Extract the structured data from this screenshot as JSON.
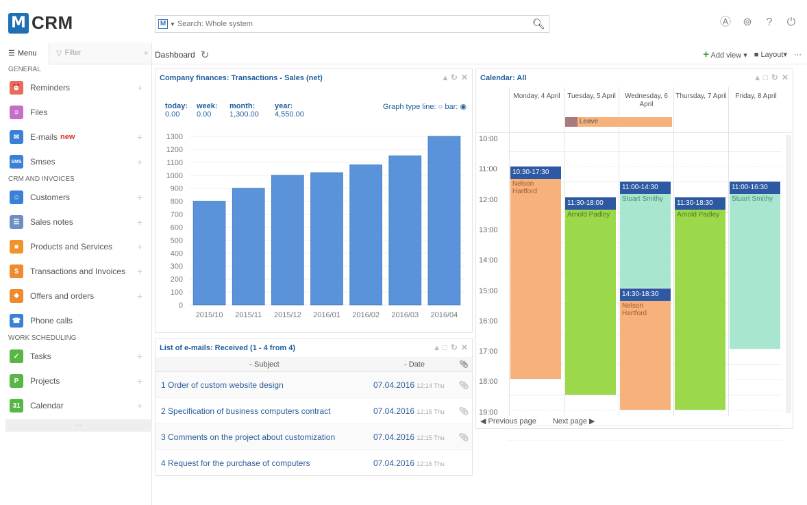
{
  "app": {
    "logo_letter": "M",
    "logo_text": "CRM"
  },
  "search": {
    "placeholder": "Search: Whole system",
    "scope_letter": "M"
  },
  "top_icons": [
    "user-circle-icon",
    "settings-circle-icon",
    "help-icon",
    "power-icon"
  ],
  "sidebar": {
    "menu_label": "Menu",
    "filter_label": "Filter",
    "sections": [
      {
        "title": "GENERAL",
        "items": [
          {
            "label": "Reminders",
            "icon": "clock-icon",
            "color": "#e76d5a",
            "plus": true
          },
          {
            "label": "Files",
            "icon": "file-icon",
            "color": "#c56fc9",
            "plus": false
          },
          {
            "label": "E-mails",
            "badge": "new",
            "icon": "email-icon",
            "color": "#3a80d6",
            "plus": true
          },
          {
            "label": "Smses",
            "icon": "sms-icon",
            "color": "#3a80d6",
            "plus": true
          }
        ]
      },
      {
        "title": "CRM AND INVOICES",
        "items": [
          {
            "label": "Customers",
            "icon": "customer-icon",
            "color": "#3a80d6",
            "plus": true
          },
          {
            "label": "Sales notes",
            "icon": "note-icon",
            "color": "#6e8fbf",
            "plus": true
          },
          {
            "label": "Products and Services",
            "icon": "box-icon",
            "color": "#f0932b",
            "plus": true
          },
          {
            "label": "Transactions and Invoices",
            "icon": "dollar-icon",
            "color": "#ef8a2f",
            "plus": true
          },
          {
            "label": "Offers and orders",
            "icon": "tag-icon",
            "color": "#ef8a2f",
            "plus": true
          },
          {
            "label": "Phone calls",
            "icon": "phone-icon",
            "color": "#3a80d6",
            "plus": false
          }
        ]
      },
      {
        "title": "WORK SCHEDULING",
        "items": [
          {
            "label": "Tasks",
            "icon": "check-icon",
            "color": "#56b746",
            "plus": true
          },
          {
            "label": "Projects",
            "icon": "project-icon",
            "color": "#56b746",
            "plus": true
          },
          {
            "label": "Calendar",
            "icon": "calendar-icon",
            "color": "#56b746",
            "plus": true
          }
        ]
      }
    ],
    "footer": "…"
  },
  "dashboard": {
    "title": "Dashboard",
    "add_view": "Add view",
    "layout": "Layout",
    "more": "···"
  },
  "finances": {
    "title": "Company finances: Transactions - Sales (net)",
    "stats_labels": [
      "today:",
      "week:",
      "month:",
      "year:"
    ],
    "stats_values": [
      "0.00",
      "0.00",
      "1,300.00",
      "4,550.00"
    ],
    "graph_type_label": "Graph type line:",
    "bar_label": "bar:",
    "selected": "bar"
  },
  "chart_data": {
    "type": "bar",
    "categories": [
      "2015/10",
      "2015/11",
      "2015/12",
      "2016/01",
      "2016/02",
      "2016/03",
      "2016/04"
    ],
    "values": [
      800,
      900,
      1000,
      1020,
      1080,
      1150,
      1300
    ],
    "yticks": [
      0,
      100,
      200,
      300,
      400,
      500,
      600,
      700,
      800,
      900,
      1000,
      1100,
      1200,
      1300
    ],
    "ylim": [
      0,
      1300
    ],
    "bar_color": "#5b93db",
    "grid": true
  },
  "emails": {
    "title": "List of e-mails: Received (1 - 4 from 4)",
    "col_subject": "Subject",
    "col_date": "Date",
    "rows": [
      {
        "num": "1",
        "subject": "Order of custom website design",
        "date": "07.04.2016",
        "time": "12:14 Thu",
        "attach": true
      },
      {
        "num": "2",
        "subject": "Specification of business computers contract",
        "date": "07.04.2016",
        "time": "12:15 Thu",
        "attach": true
      },
      {
        "num": "3",
        "subject": "Comments on the project about customization",
        "date": "07.04.2016",
        "time": "12:15 Thu",
        "attach": true
      },
      {
        "num": "4",
        "subject": "Request for the purchase of computers",
        "date": "07.04.2016",
        "time": "12:16 Thu",
        "attach": false
      }
    ]
  },
  "calendar": {
    "title": "Calendar: All",
    "days": [
      "Monday, 4 April",
      "Tuesday, 5 April",
      "Wednesday, 6 April",
      "Thursday, 7 April",
      "Friday, 8 April"
    ],
    "hours": [
      "10:00",
      "11:00",
      "12:00",
      "13:00",
      "14:00",
      "15:00",
      "16:00",
      "17:00",
      "18:00",
      "19:00"
    ],
    "allday": {
      "label": "Leave",
      "color": "#f7b17b"
    },
    "events": [
      {
        "day": 0,
        "start": 10.5,
        "end": 17.5,
        "time": "10:30-17:30",
        "text": "Nelson Hartford",
        "color": "#f7b17b"
      },
      {
        "day": 1,
        "start": 11.5,
        "end": 18.0,
        "time": "11:30-18:00",
        "text": "Arnold Padley",
        "color": "#9bd84a"
      },
      {
        "day": 2,
        "start": 11.0,
        "end": 14.5,
        "time": "11:00-14:30",
        "text": "Stuart Smithy",
        "color": "#a8e6cf"
      },
      {
        "day": 2,
        "start": 14.5,
        "end": 18.5,
        "time": "14:30-18:30",
        "text": "Nelson Hartford",
        "color": "#f7b17b"
      },
      {
        "day": 3,
        "start": 11.5,
        "end": 18.5,
        "time": "11:30-18:30",
        "text": "Arnold Padley",
        "color": "#9bd84a"
      },
      {
        "day": 4,
        "start": 11.0,
        "end": 16.5,
        "time": "11:00-16:30",
        "text": "Stuart Smithy",
        "color": "#a8e6cf"
      }
    ],
    "prev": "Previous page",
    "next": "Next page"
  }
}
